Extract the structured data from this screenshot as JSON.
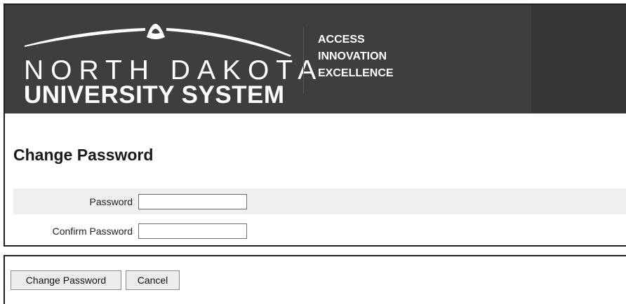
{
  "header": {
    "logo": {
      "line1": "NORTH DAKOTA",
      "line2": "UNIVERSITY SYSTEM"
    },
    "tagline": [
      "ACCESS",
      "INNOVATION",
      "EXCELLENCE"
    ]
  },
  "form": {
    "title": "Change Password",
    "fields": [
      {
        "label": "Password",
        "value": ""
      },
      {
        "label": "Confirm Password",
        "value": ""
      }
    ]
  },
  "actions": {
    "submit_label": "Change Password",
    "cancel_label": "Cancel"
  },
  "colors": {
    "header_bg": "#3e3e3e",
    "row_alt_bg": "#efefef"
  }
}
